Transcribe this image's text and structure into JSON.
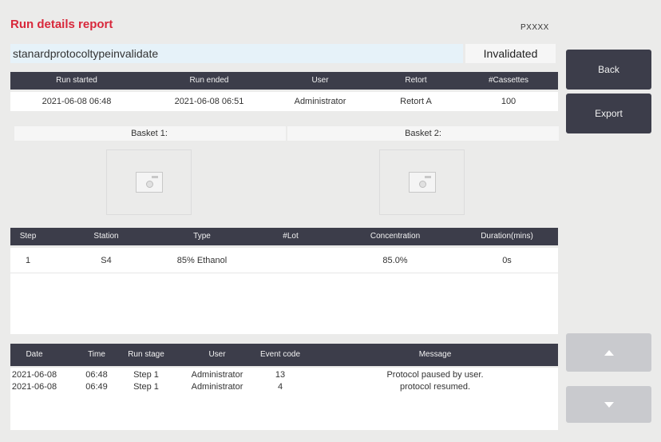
{
  "header": {
    "title": "Run details report",
    "code": "PXXXX",
    "protocol_name": "stanardprotocoltypeinvalidate",
    "status": "Invalidated"
  },
  "run_table": {
    "columns": [
      "Run started",
      "Run ended",
      "User",
      "Retort",
      "#Cassettes"
    ],
    "row": [
      "2021-06-08 06:48",
      "2021-06-08 06:51",
      "Administrator",
      "Retort A",
      "100"
    ]
  },
  "baskets": [
    {
      "label": "Basket 1:"
    },
    {
      "label": "Basket 2:"
    }
  ],
  "steps_table": {
    "columns": [
      "Step",
      "Station",
      "Type",
      "#Lot",
      "Concentration",
      "Duration(mins)"
    ],
    "rows": [
      [
        "1",
        "S4",
        "85% Ethanol",
        "",
        "85.0%",
        "0s"
      ]
    ]
  },
  "events_table": {
    "columns": [
      "Date",
      "Time",
      "Run stage",
      "User",
      "Event code",
      "Message"
    ],
    "rows": [
      [
        "2021-06-08",
        "06:48",
        "Step 1",
        "Administrator",
        "13",
        "Protocol paused by user."
      ],
      [
        "2021-06-08",
        "06:49",
        "Step 1",
        "Administrator",
        "4",
        "protocol resumed."
      ]
    ]
  },
  "buttons": {
    "back": "Back",
    "export": "Export",
    "up_icon": "chevron-up-icon",
    "down_icon": "chevron-down-icon"
  },
  "colors": {
    "title": "#d8283b",
    "header_bg": "#3c3d4a",
    "page_bg": "#ebebea",
    "protocol_bg": "#e6f2f9"
  }
}
